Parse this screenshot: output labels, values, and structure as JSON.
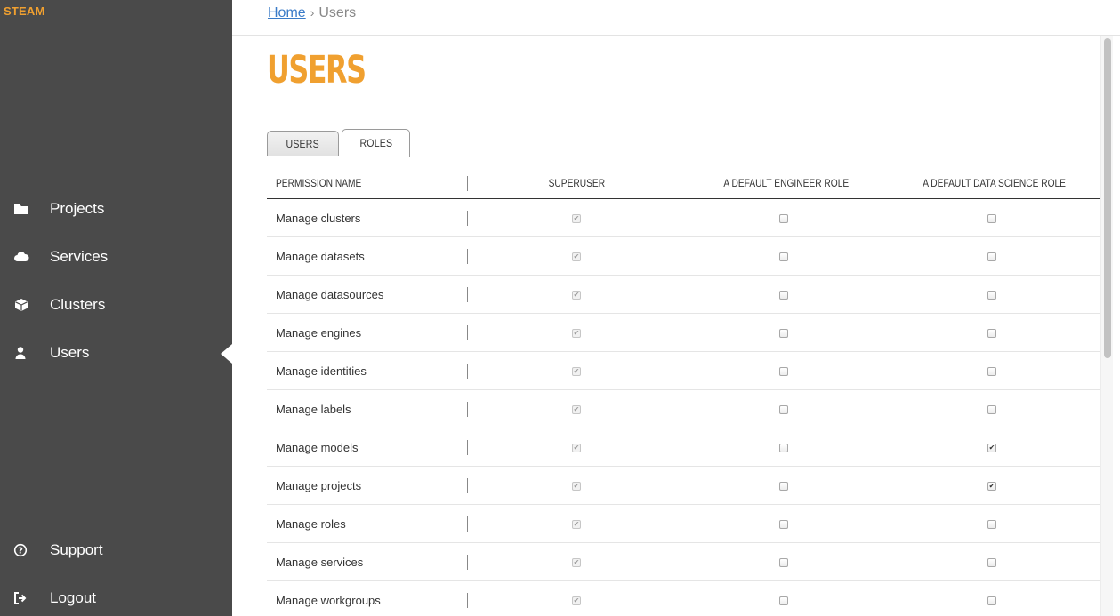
{
  "brand": "STEAM",
  "sidebar": {
    "items": [
      {
        "label": "Projects",
        "icon": "folder-icon"
      },
      {
        "label": "Services",
        "icon": "cloud-icon"
      },
      {
        "label": "Clusters",
        "icon": "cube-icon"
      },
      {
        "label": "Users",
        "icon": "user-icon",
        "active": true
      }
    ],
    "bottom_items": [
      {
        "label": "Support",
        "icon": "help-circle-icon"
      },
      {
        "label": "Logout",
        "icon": "logout-icon"
      }
    ]
  },
  "breadcrumb": {
    "home": "Home",
    "current": "Users"
  },
  "page": {
    "title": "USERS"
  },
  "tabs": [
    {
      "label": "USERS",
      "active": false
    },
    {
      "label": "ROLES",
      "active": true
    }
  ],
  "table": {
    "headers": [
      "PERMISSION NAME",
      "SUPERUSER",
      "A DEFAULT ENGINEER ROLE",
      "A DEFAULT DATA SCIENCE ROLE"
    ],
    "rows": [
      {
        "name": "Manage clusters",
        "superuser": true,
        "engineer": false,
        "data_science": false
      },
      {
        "name": "Manage datasets",
        "superuser": true,
        "engineer": false,
        "data_science": false
      },
      {
        "name": "Manage datasources",
        "superuser": true,
        "engineer": false,
        "data_science": false
      },
      {
        "name": "Manage engines",
        "superuser": true,
        "engineer": false,
        "data_science": false
      },
      {
        "name": "Manage identities",
        "superuser": true,
        "engineer": false,
        "data_science": false
      },
      {
        "name": "Manage labels",
        "superuser": true,
        "engineer": false,
        "data_science": false
      },
      {
        "name": "Manage models",
        "superuser": true,
        "engineer": false,
        "data_science": true
      },
      {
        "name": "Manage projects",
        "superuser": true,
        "engineer": false,
        "data_science": true
      },
      {
        "name": "Manage roles",
        "superuser": true,
        "engineer": false,
        "data_science": false
      },
      {
        "name": "Manage services",
        "superuser": true,
        "engineer": false,
        "data_science": false
      },
      {
        "name": "Manage workgroups",
        "superuser": true,
        "engineer": false,
        "data_science": false
      }
    ]
  },
  "colors": {
    "accent": "#f0a030",
    "sidebar": "#4a4a4a",
    "link": "#3a7bc8"
  }
}
